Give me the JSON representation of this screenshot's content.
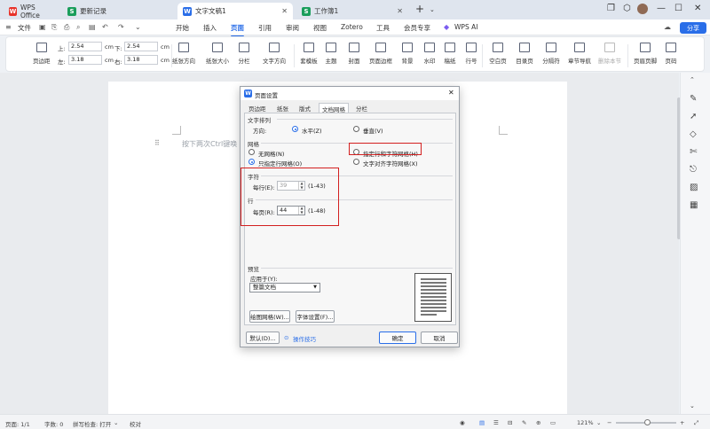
{
  "titlebar": {
    "tabs": [
      {
        "label": "WPS Office",
        "icon": "wps-logo-icon"
      },
      {
        "label": "更新记录",
        "icon": "sheet-icon"
      },
      {
        "label": "文字文稿1",
        "icon": "writer-icon",
        "active": true
      },
      {
        "label": "工作簿1",
        "icon": "sheet-icon"
      }
    ],
    "new_tab": "+"
  },
  "menubar": {
    "file": "文件",
    "items": [
      "开始",
      "插入",
      "页面",
      "引用",
      "审阅",
      "视图",
      "Zotero",
      "工具",
      "会员专享"
    ],
    "active": "页面",
    "wps_ai": "WPS AI",
    "share": "分享"
  },
  "ribbon": {
    "margin_label": "页边距",
    "margins": {
      "top_label": "上:",
      "top": "2.54",
      "bottom_label": "下:",
      "bottom": "2.54",
      "left_label": "左:",
      "left": "3.18",
      "right_label": "右:",
      "right": "3.18",
      "unit": "cm"
    },
    "buttons": [
      "纸张方向",
      "纸张大小",
      "分栏",
      "文字方向",
      "套模板",
      "主题",
      "封面",
      "页面边框",
      "背景",
      "水印",
      "稿纸",
      "行号",
      "空白页",
      "目录页",
      "分隔符",
      "章节导航",
      "删除本节",
      "页眉页脚",
      "页码"
    ]
  },
  "document": {
    "hint": "按下两次Ctrl键唤"
  },
  "dialog": {
    "title": "页面设置",
    "tabs": [
      "页边距",
      "纸张",
      "版式",
      "文档网格",
      "分栏"
    ],
    "active_tab": "文档网格",
    "text_direction": {
      "section": "文字排列",
      "label": "方向:",
      "horizontal": "水平(Z)",
      "vertical": "垂直(V)"
    },
    "grid": {
      "section": "网格",
      "none": "无网格(N)",
      "lines_only": "只指定行网格(O)",
      "lines_chars": "指定行和字符网格(H)",
      "snap_chars": "文字对齐字符网格(X)"
    },
    "chars": {
      "section": "字符",
      "label": "每行(E):",
      "value": "39",
      "range": "(1-43)"
    },
    "lines": {
      "section": "行",
      "label": "每页(R):",
      "value": "44",
      "range": "(1-48)"
    },
    "preview": {
      "section": "预览",
      "apply_label": "应用于(Y):",
      "apply_value": "整篇文档"
    },
    "buttons": {
      "draw_grid": "绘图网格(W)...",
      "font_settings": "字体设置(F)...",
      "default": "默认(D)...",
      "tips": "操作技巧",
      "ok": "确定",
      "cancel": "取消"
    }
  },
  "statusbar": {
    "page": "页面: 1/1",
    "words": "字数: 0",
    "spell": "拼写检查: 打开",
    "proof": "校对",
    "zoom": "121%"
  }
}
